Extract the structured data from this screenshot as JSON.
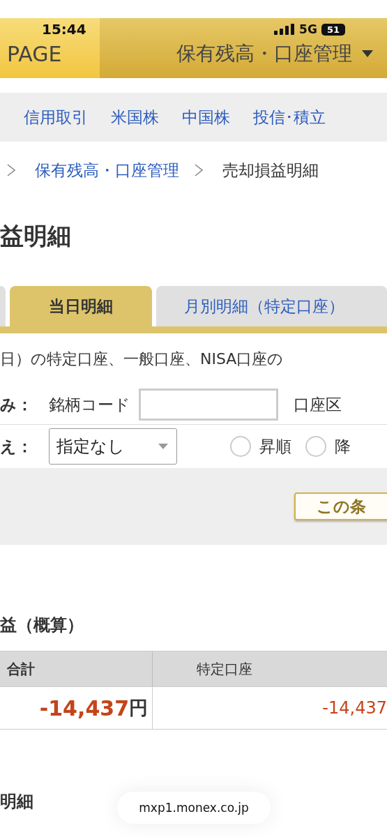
{
  "status_bar": {
    "time": "15:44",
    "network": "5G",
    "battery": "51"
  },
  "header": {
    "page_label": "PAGE",
    "title": "保有残高・口座管理"
  },
  "nav": [
    {
      "label": "信用取引"
    },
    {
      "label": "米国株"
    },
    {
      "label": "中国株"
    },
    {
      "label": "投信･積立"
    }
  ],
  "breadcrumb": [
    {
      "label": "保有残高・口座管理",
      "link": true
    },
    {
      "label": "売却損益明細",
      "link": false
    }
  ],
  "page_title": "益明細",
  "tabs": [
    {
      "label": "当日明細",
      "selected": true
    },
    {
      "label": "月別明細（特定口座）",
      "selected": false
    }
  ],
  "description": "日）の特定口座、一般口座、NISA口座の",
  "filter": {
    "label": "み：",
    "code_label": "銘柄コード",
    "account_label": "口座区"
  },
  "sort": {
    "label": "え：",
    "value": "指定なし",
    "options": [
      {
        "label": "昇順",
        "selected": false
      },
      {
        "label": "降",
        "selected": false
      }
    ]
  },
  "search_button": "この条",
  "summary": {
    "title": "益（概算）",
    "columns": [
      "合計",
      "特定口座"
    ],
    "total": "-14,437",
    "unit": "円",
    "specific": "-14,437"
  },
  "section_title": "明細",
  "url": "mxp1.monex.co.jp"
}
